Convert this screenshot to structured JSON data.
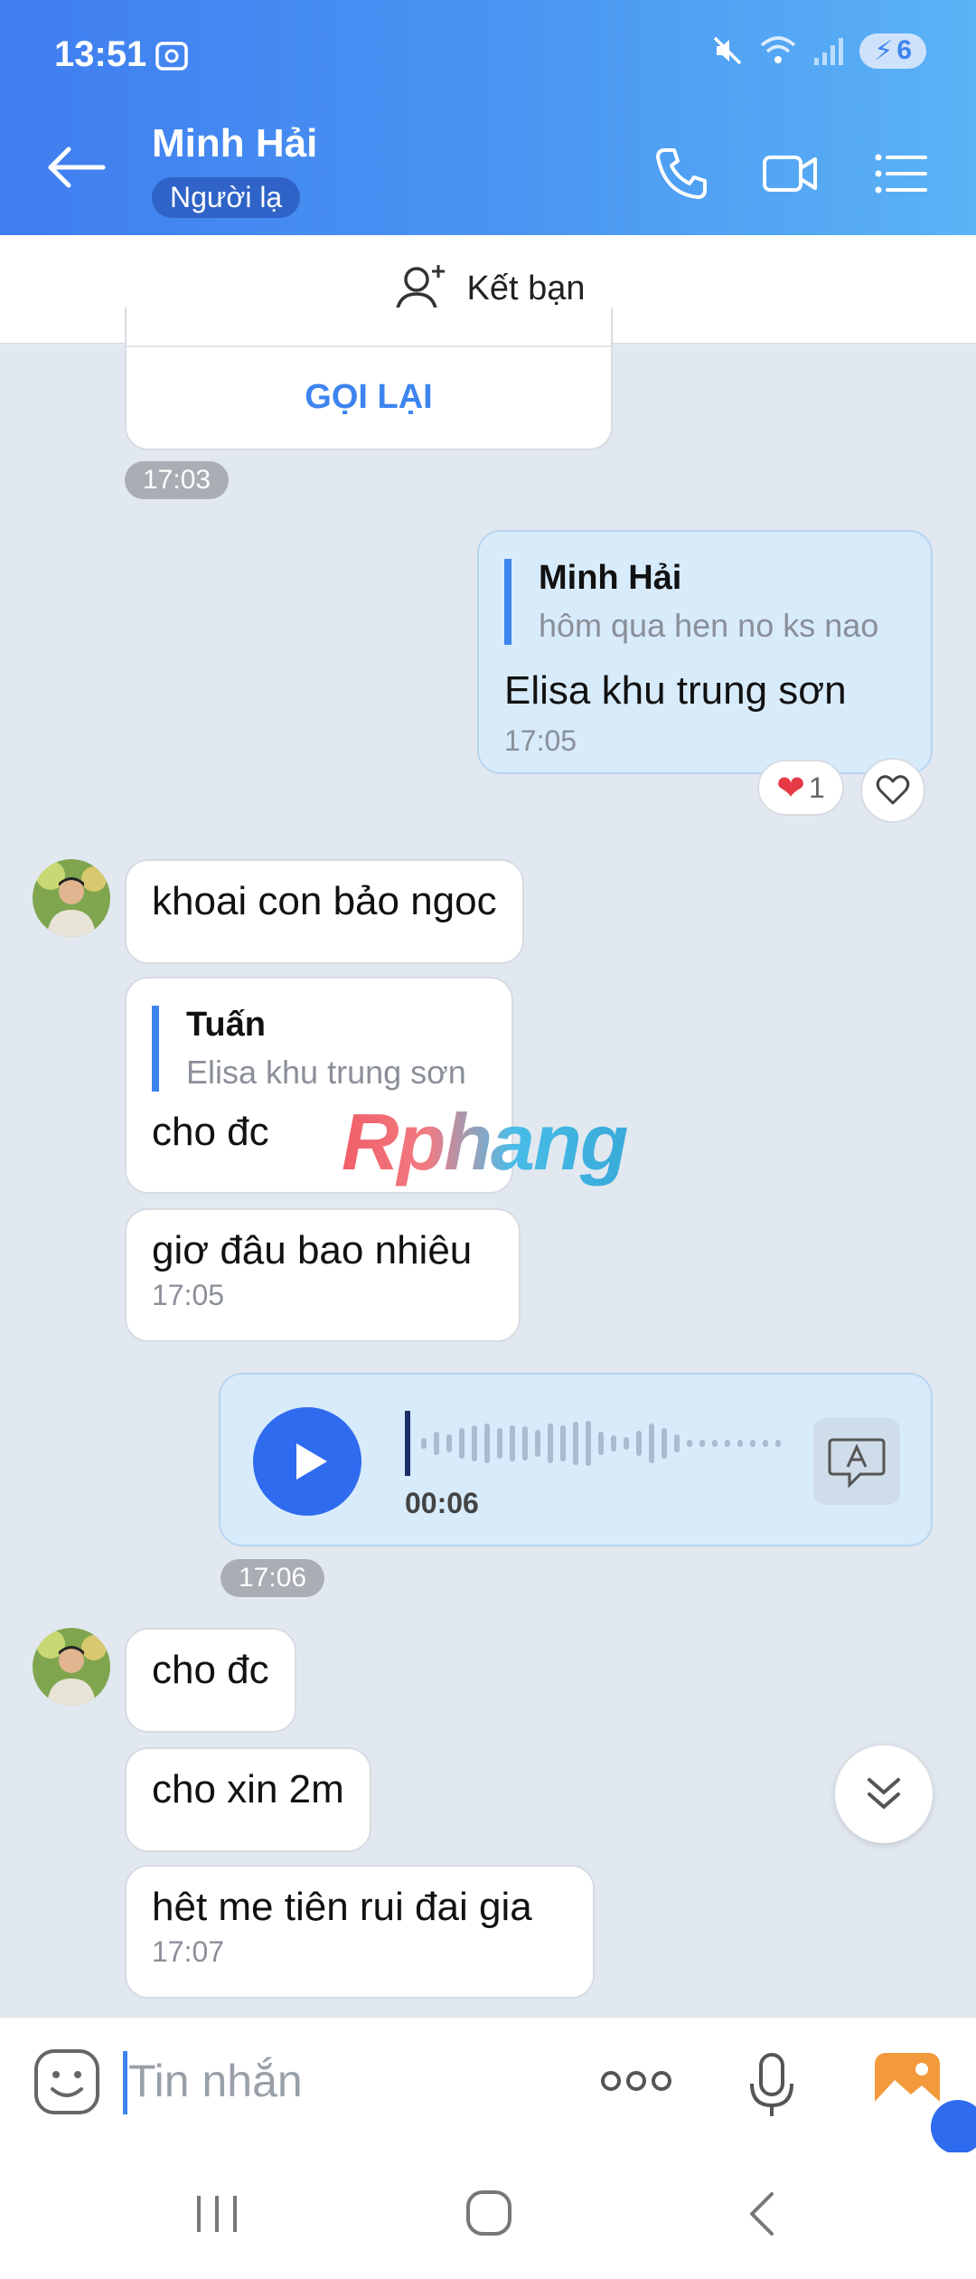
{
  "status_bar": {
    "time": "13:51",
    "battery": "6"
  },
  "header": {
    "name": "Minh Hải",
    "badge": "Người lạ"
  },
  "add_friend": {
    "label": "Kết bạn"
  },
  "call_card": {
    "action": "GỌI LẠI",
    "time": "17:03"
  },
  "messages": [
    {
      "direction": "sent",
      "quote_name": "Minh Hải",
      "quote_text": "hôm qua hen no ks nao",
      "text": "Elisa khu trung sơn",
      "time": "17:05",
      "reaction_count": "1"
    },
    {
      "direction": "received",
      "text": "khoai con bảo ngoc"
    },
    {
      "direction": "received",
      "quote_name": "Tuấn",
      "quote_text": "Elisa khu trung sơn",
      "text": "cho đc"
    },
    {
      "direction": "received",
      "text": "giơ đâu bao nhiêu",
      "time": "17:05"
    },
    {
      "direction": "sent",
      "type": "voice",
      "duration": "00:06",
      "time": "17:06"
    },
    {
      "direction": "received",
      "text": "cho đc"
    },
    {
      "direction": "received",
      "text": "cho xin 2m"
    },
    {
      "direction": "received",
      "text": "hêt me tiên rui đai gia",
      "time": "17:07"
    }
  ],
  "input": {
    "placeholder": "Tin nhắn"
  },
  "watermark": "Rphang",
  "colors": {
    "accent": "#3d84ef",
    "header_start": "#3f7df0",
    "header_end": "#5bb3f5",
    "sent_bubble": "#d7ebfb"
  }
}
